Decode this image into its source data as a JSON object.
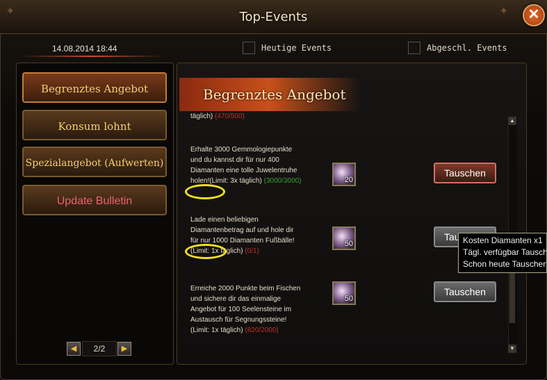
{
  "window": {
    "title": "Top-Events",
    "close_label": "✕"
  },
  "header": {
    "datetime": "14.08.2014 18:44",
    "filters": [
      {
        "label": "Heutige Events",
        "checked": false
      },
      {
        "label": "Abgeschl. Events",
        "checked": false
      }
    ]
  },
  "sidebar": {
    "items": [
      {
        "label": "Begrenztes Angebot"
      },
      {
        "label": "Konsum lohnt"
      },
      {
        "label": "Spezialangebot (Aufwerten)"
      },
      {
        "label": "Update Bulletin"
      }
    ],
    "pager": {
      "text": "2/2",
      "prev_icon": "◀",
      "next_icon": "▶"
    }
  },
  "main": {
    "heading": "Begrenztes Angebot",
    "partial_top": {
      "text": "täglich) ",
      "limit": "(470/500)"
    },
    "events": [
      {
        "text": "Erhalte 3000 Gemmologiepunkte und du kannst dir für nur 400 Diamanten eine tolle Juwelentruhe holen!(Limit: 3x täglich) ",
        "limit": "(3000/3000)",
        "limit_color": "green",
        "gem_count": "20",
        "button_label": "Tauschen"
      },
      {
        "text": "Lade einen beliebigen Diamantenbetrag auf und hole dir für nur 1000 Diamanten Fußbälle!(Limit: 1x täglich) ",
        "limit": "(0/1)",
        "limit_color": "red",
        "gem_count": "50",
        "button_label": "Tauschen"
      },
      {
        "text": "Erreiche 2000 Punkte beim Fischen und sichere dir das einmalige Angebot für 100 Seelensteine im Austausch für Segnungssteine! (Limit: 1x täglich) ",
        "limit": "(820/2000)",
        "limit_color": "red",
        "gem_count": "50",
        "button_label": "Tauschen"
      }
    ]
  },
  "tooltip": {
    "lines": [
      "Kosten  Diamanten x1",
      "Tägl. verfügbar Tausch",
      "Schon heute Tauschen"
    ]
  },
  "scrollbar": {
    "up_icon": "▲",
    "down_icon": "▼"
  }
}
